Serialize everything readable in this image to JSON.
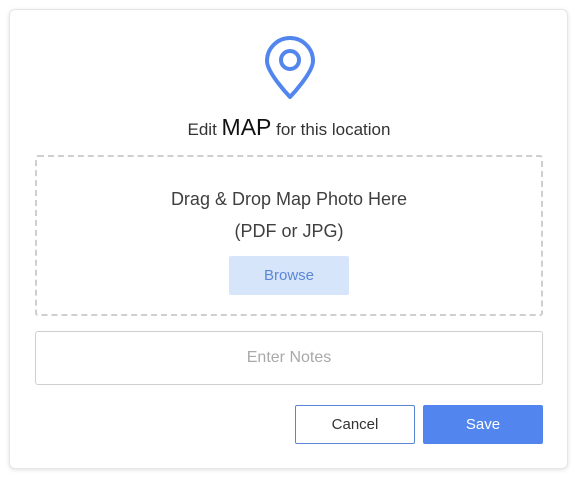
{
  "icon": {
    "name": "map-pin-icon",
    "color": "#5286ee"
  },
  "heading": {
    "prefix": "Edit",
    "emphasis": "MAP",
    "suffix": "for this location"
  },
  "dropzone": {
    "line1": "Drag & Drop Map Photo Here",
    "line2": "(PDF or JPG)",
    "browse_label": "Browse"
  },
  "notes": {
    "placeholder": "Enter Notes",
    "value": ""
  },
  "actions": {
    "cancel_label": "Cancel",
    "save_label": "Save"
  },
  "colors": {
    "accent": "#5286ee",
    "browse_bg": "#d7e5fb",
    "browse_text": "#5b86d6",
    "border": "#cfcfcf"
  }
}
